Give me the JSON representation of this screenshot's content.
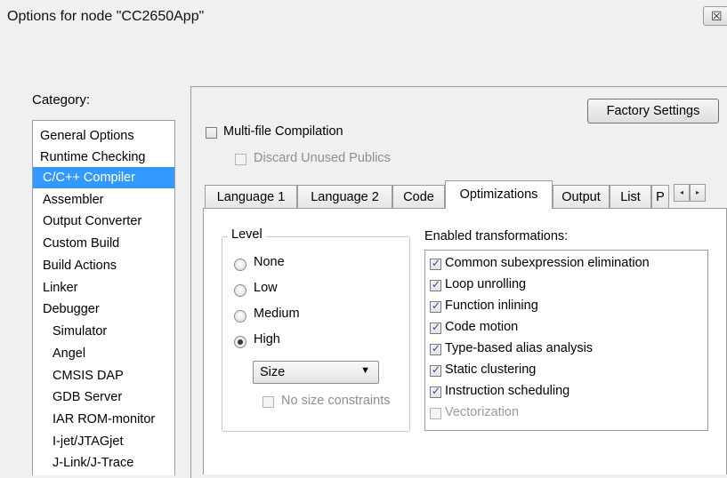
{
  "window": {
    "title": "Options for node \"CC2650App\"",
    "close_symbol": "☒"
  },
  "category": {
    "label": "Category:",
    "items": [
      {
        "label": "General Options"
      },
      {
        "label": "Runtime Checking"
      },
      {
        "label": "C/C++ Compiler",
        "selected": true
      },
      {
        "label": "Assembler"
      },
      {
        "label": "Output Converter"
      },
      {
        "label": "Custom Build"
      },
      {
        "label": "Build Actions"
      },
      {
        "label": "Linker"
      },
      {
        "label": "Debugger"
      },
      {
        "label": "Simulator"
      },
      {
        "label": "Angel"
      },
      {
        "label": "CMSIS DAP"
      },
      {
        "label": "GDB Server"
      },
      {
        "label": "IAR ROM-monitor"
      },
      {
        "label": "I-jet/JTAGjet"
      },
      {
        "label": "J-Link/J-Trace"
      }
    ]
  },
  "factory_settings": {
    "label": "Factory Settings"
  },
  "multifile": {
    "label": "Multi-file Compilation",
    "checked": false
  },
  "discard_unused": {
    "label": "Discard Unused Publics",
    "checked": false,
    "enabled": false
  },
  "tabs": [
    {
      "label": "Language 1"
    },
    {
      "label": "Language 2"
    },
    {
      "label": "Code"
    },
    {
      "label": "Optimizations",
      "active": true
    },
    {
      "label": "Output"
    },
    {
      "label": "List"
    },
    {
      "label": "P"
    }
  ],
  "tab_scroll": {
    "left": "◂",
    "right": "▸"
  },
  "level": {
    "title": "Level",
    "options": [
      {
        "label": "None",
        "checked": false
      },
      {
        "label": "Low",
        "checked": false
      },
      {
        "label": "Medium",
        "checked": false
      },
      {
        "label": "High",
        "checked": true
      }
    ],
    "mode_select": {
      "value": "Size",
      "arrow": "▼"
    },
    "no_size_constraints": {
      "label": "No size constraints",
      "checked": false,
      "enabled": false
    }
  },
  "transformations": {
    "title": "Enabled transformations:",
    "items": [
      {
        "label": "Common subexpression elimination",
        "checked": true,
        "enabled": true
      },
      {
        "label": "Loop unrolling",
        "checked": true,
        "enabled": true
      },
      {
        "label": "Function inlining",
        "checked": true,
        "enabled": true
      },
      {
        "label": "Code motion",
        "checked": true,
        "enabled": true
      },
      {
        "label": "Type-based alias analysis",
        "checked": true,
        "enabled": true
      },
      {
        "label": "Static clustering",
        "checked": true,
        "enabled": true
      },
      {
        "label": "Instruction scheduling",
        "checked": true,
        "enabled": true
      },
      {
        "label": "Vectorization",
        "checked": false,
        "enabled": false
      }
    ]
  }
}
